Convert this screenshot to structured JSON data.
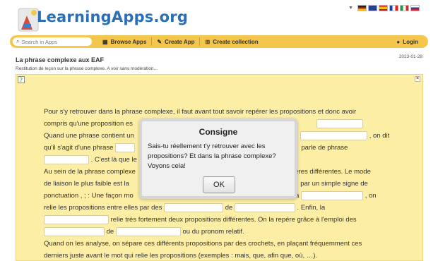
{
  "header": {
    "logo_text": "LearningApps.org",
    "languages": [
      "de",
      "en",
      "es",
      "fr",
      "it",
      "ru"
    ]
  },
  "nav": {
    "search_placeholder": "Search in Apps",
    "browse_label": "Browse Apps",
    "create_label": "Create App",
    "collection_label": "Create collection",
    "login_label": "Login"
  },
  "app": {
    "title": "La phrase complexe aux EAF",
    "date": "2023-01-28",
    "subtitle": "Restitution de leçon sur la phrase complexe. A voir sans modération..."
  },
  "content": {
    "l1": "Pour s'y retrouver dans la phrase complexe, il faut avant tout savoir repérer les propositions et donc avoir",
    "l2a": "compris qu'une proposition es",
    "l3a": "Quand une phrase contient un",
    "l3b": ", on dit",
    "l4a": "qu'il s'agit d'une phrase",
    "l4b": "parle de phrase",
    "l5b": ". C'est là que le",
    "l6a": "Au sein de la phrase complexe",
    "l6b": "ières différentes. Le mode",
    "l7a": "de liaison le plus faible est la",
    "l7b": "par un simple signe de",
    "l8a": "ponctuation , ; : Une façon mo",
    "l8b": "la",
    "l8c": ", on",
    "l9a": "relie les propositions entre elles par des",
    "l9b": "de",
    "l9c": ". Enfin, la",
    "l10b": "relie très fortement deux propositions différentes. On la repère grâce à l'emploi des",
    "l11b": "de",
    "l11c": "ou du pronom relatif.",
    "l12": "Quand on les analyse, on sépare ces différents propositions par des crochets, en plaçant fréquemment ces",
    "l13": "derniers juste avant le mot qui relie les propositions (exemples : mais, que, afin que, où, …)."
  },
  "modal": {
    "title": "Consigne",
    "text": "Sais-tu réellement t'y retrouver avec les propositions? Et dans la phrase complexe? Voyons cela!",
    "ok_label": "OK"
  },
  "colors": {
    "nav_bg": "#f4c64b",
    "app_bg": "#fdeea6",
    "logo": "#2a6fb8"
  }
}
